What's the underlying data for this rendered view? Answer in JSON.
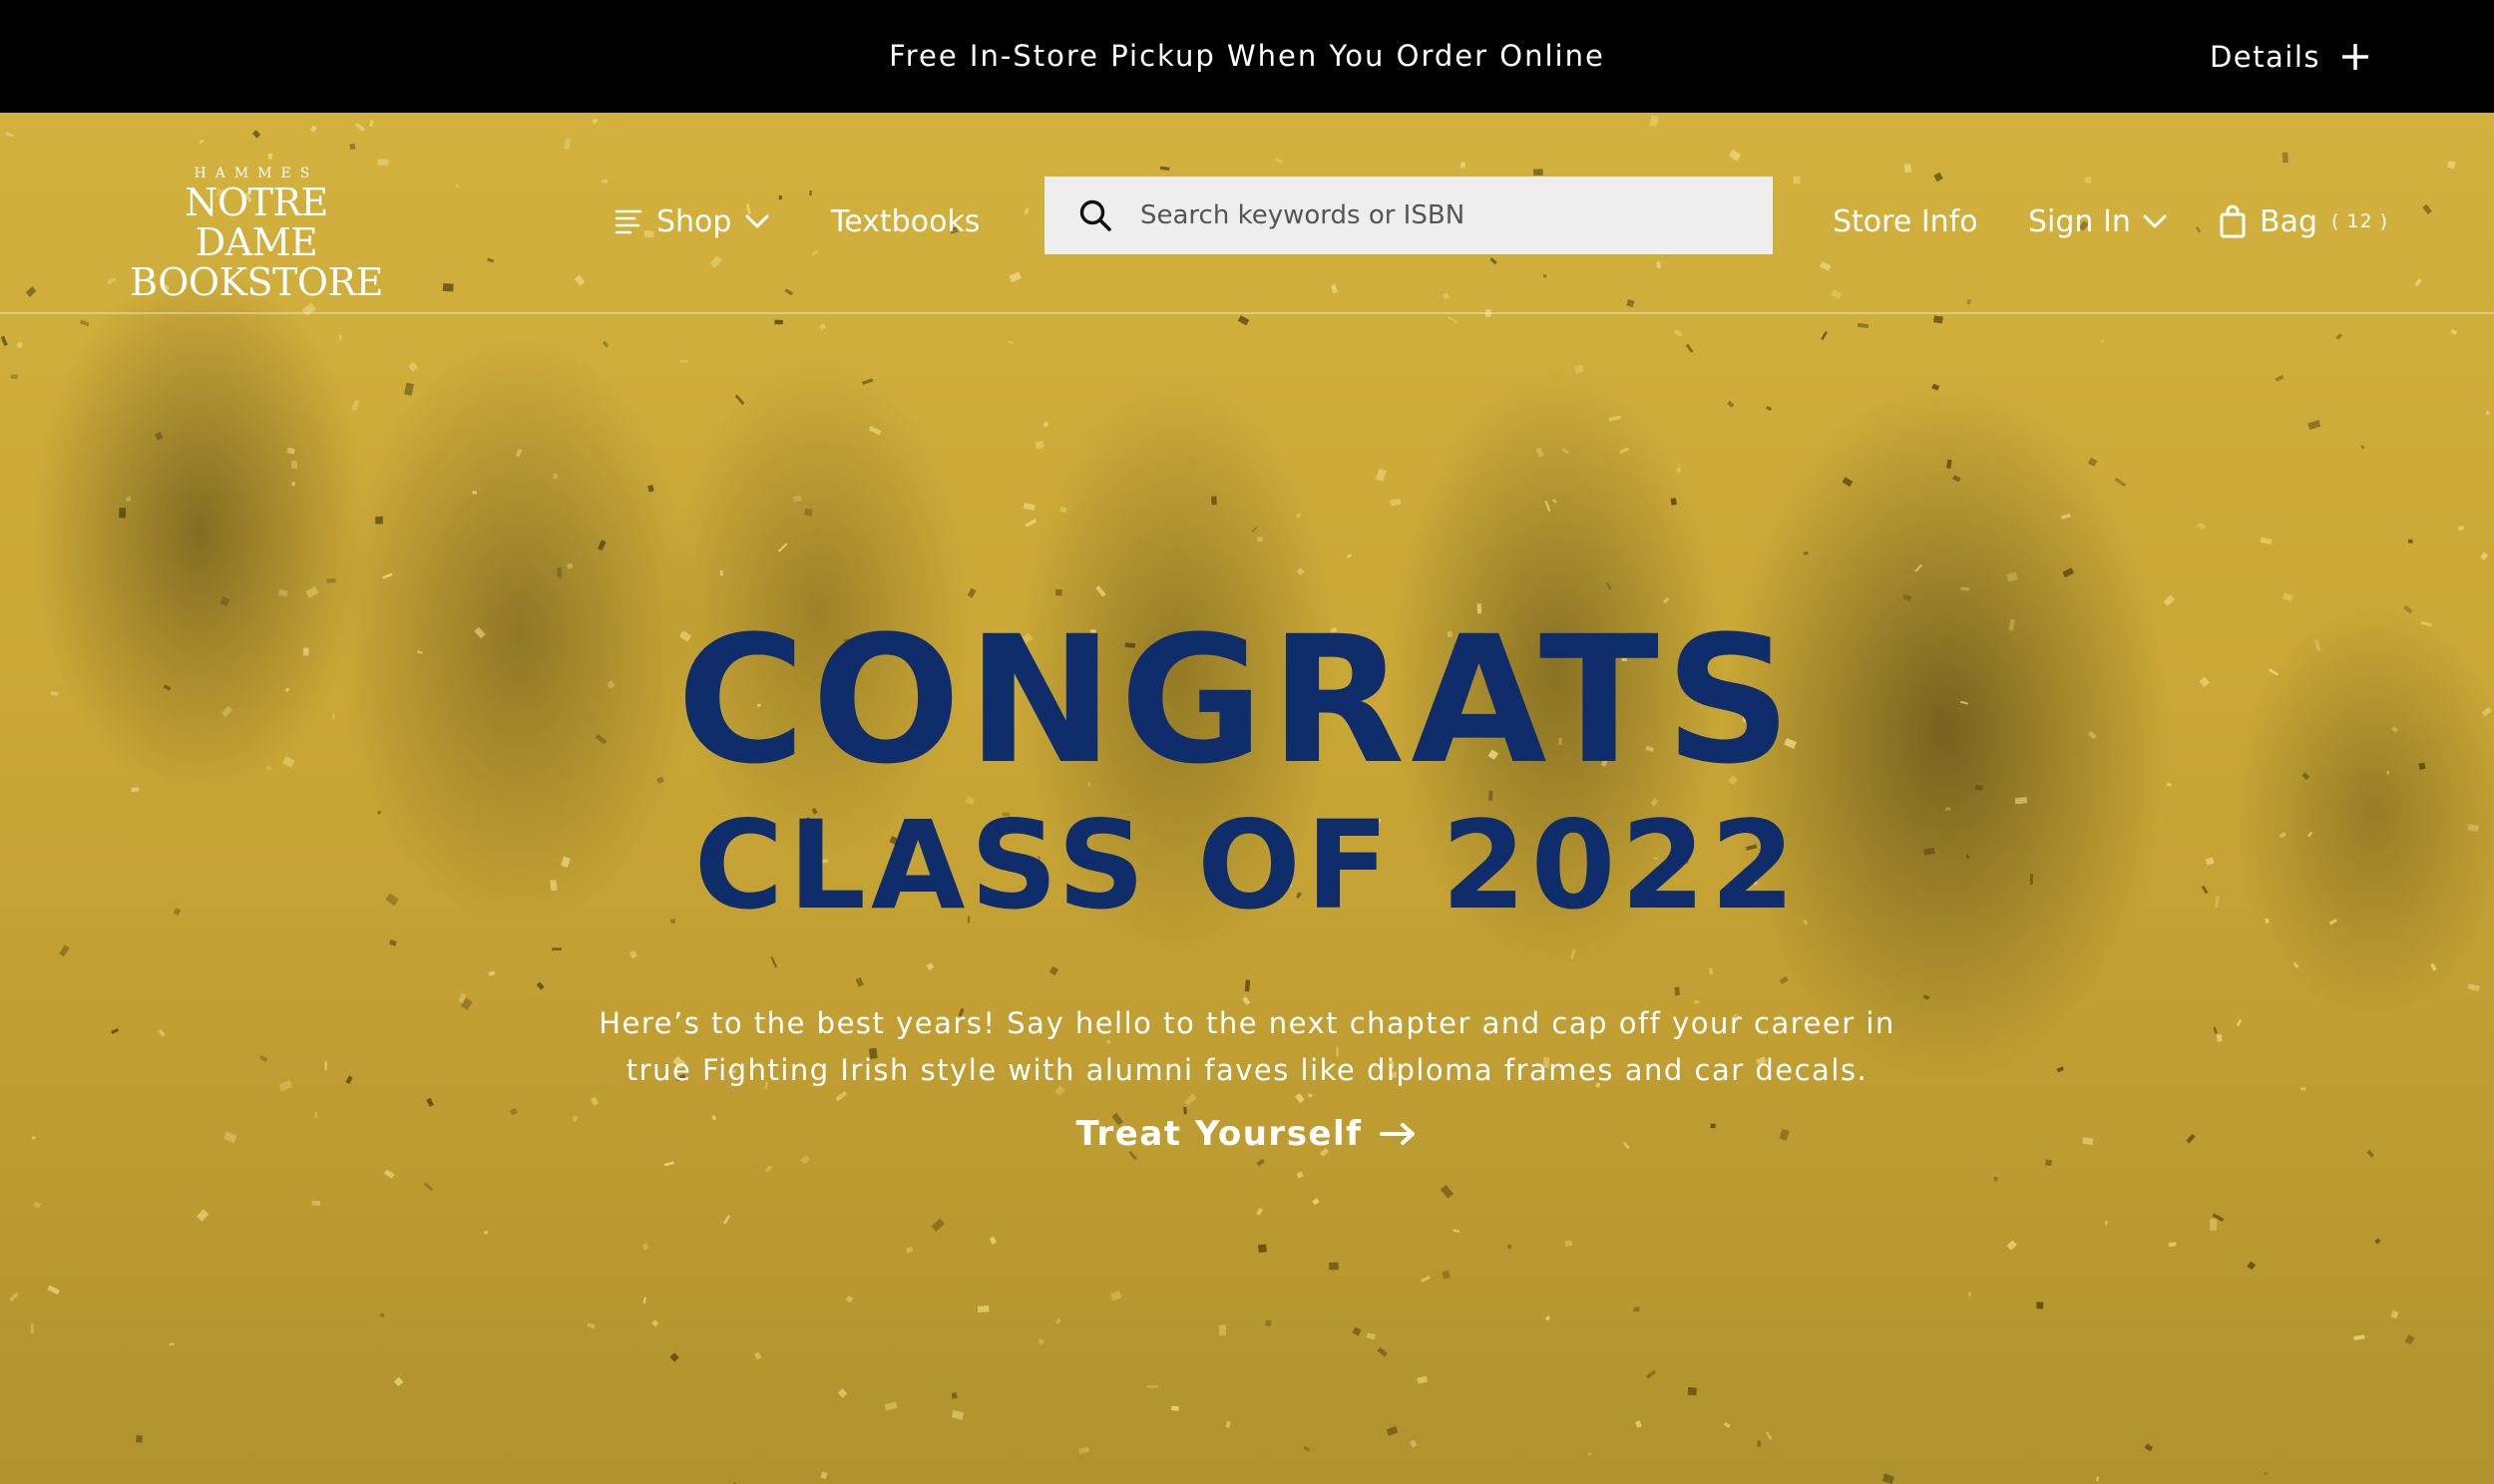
{
  "announcement": {
    "text": "Free In-Store Pickup When You Order Online",
    "details_label": "Details"
  },
  "header": {
    "logo": {
      "top": "HAMMES",
      "line1": "NOTRE DAME",
      "line2": "BOOKSTORE"
    },
    "nav": {
      "shop_label": "Shop",
      "textbooks_label": "Textbooks",
      "store_info_label": "Store Info",
      "sign_in_label": "Sign In",
      "bag_label": "Bag",
      "bag_count": "( 12 )"
    },
    "search": {
      "placeholder": "Search keywords or ISBN"
    }
  },
  "hero": {
    "headline1": "CONGRATS",
    "headline2": "CLASS OF 2022",
    "subcopy_line1": "Here’s to the best years! Say hello to the next chapter and cap off your career in",
    "subcopy_line2": "true Fighting Irish style with alumni faves like diploma frames and car decals.",
    "cta_label": "Treat Yourself"
  },
  "colors": {
    "hero_gold": "#c9a63a",
    "headline_navy": "#0f2d6b",
    "announcement_bg": "#000000"
  },
  "icons": [
    "plus-icon",
    "menu-icon",
    "chevron-down-icon",
    "search-icon",
    "bag-icon",
    "arrow-right-icon"
  ]
}
